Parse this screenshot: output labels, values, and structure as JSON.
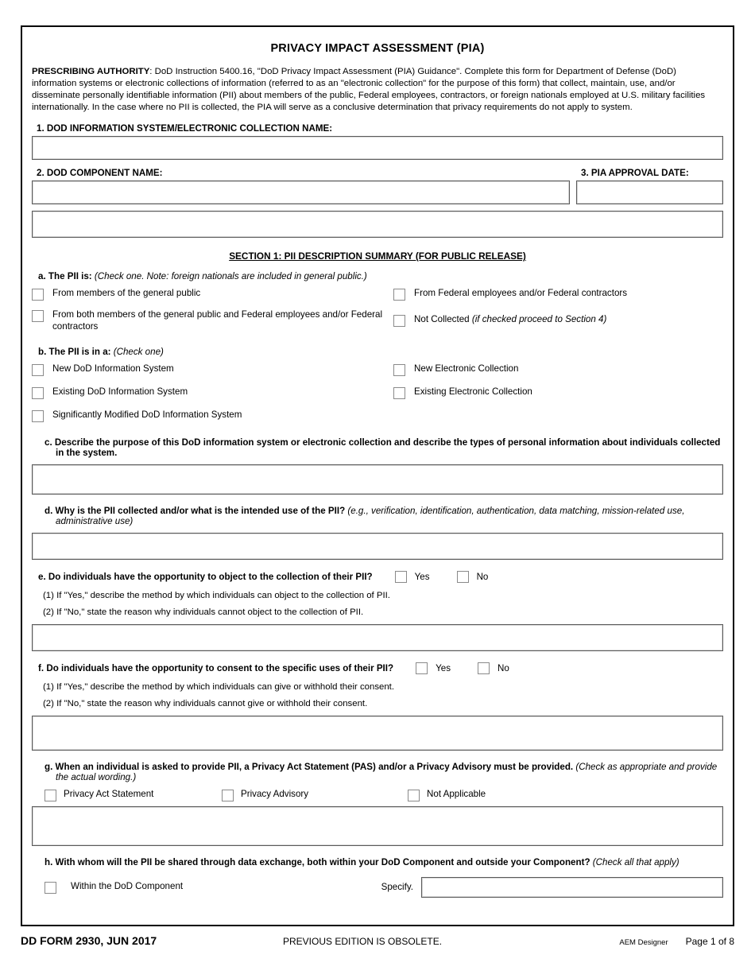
{
  "form": {
    "title": "PRIVACY IMPACT ASSESSMENT (PIA)",
    "prescribing_label": "PRESCRIBING AUTHORITY",
    "prescribing_text": ":  DoD Instruction 5400.16, \"DoD Privacy Impact Assessment (PIA) Guidance\".  Complete this form for Department of Defense (DoD) information systems or electronic collections of information (referred to as an \"electronic collection\" for the purpose of this form) that collect, maintain, use, and/or disseminate personally identifiable information (PII) about members of the public, Federal employees, contractors, or foreign nationals employed at U.S. military facilities internationally.  In the case where no PII is collected, the PIA will serve as a conclusive determination that privacy requirements do not apply to system."
  },
  "fields": {
    "f1_label": "1. DOD INFORMATION SYSTEM/ELECTRONIC COLLECTION NAME:",
    "f1_value": "",
    "f2_label": "2. DOD COMPONENT NAME:",
    "f2_value": "",
    "f3_label": "3. PIA  APPROVAL DATE:",
    "f3_value": "",
    "f4_value": ""
  },
  "section1": {
    "heading": "SECTION 1: PII DESCRIPTION SUMMARY (FOR PUBLIC RELEASE)",
    "a": {
      "letter": "a.",
      "label": "The PII is:",
      "note": "(Check one.  Note: foreign nationals are included in general public.)",
      "options_left": [
        "From members of the general public",
        "From both members of the general public and Federal employees and/or Federal contractors"
      ],
      "options_right_1": "From Federal employees and/or Federal contractors",
      "options_right_2_plain": "Not Collected ",
      "options_right_2_italic": "(if checked proceed to Section 4)"
    },
    "b": {
      "letter": "b.",
      "label": "The PII is in a:",
      "note": "(Check one)",
      "options_left": [
        "New DoD Information System",
        "Existing DoD Information System",
        "Significantly Modified DoD Information System"
      ],
      "options_right": [
        "New Electronic Collection",
        "Existing Electronic Collection"
      ]
    },
    "c": {
      "letter": "c.",
      "text": "Describe the purpose of this DoD information system or electronic collection and describe the types of personal information about individuals collected in the system.",
      "value": ""
    },
    "d": {
      "letter": "d.",
      "text": "Why is the PII collected and/or what is the intended use of the PII?",
      "note": "(e.g., verification, identification, authentication, data matching, mission-related use, administrative use)",
      "value": ""
    },
    "e": {
      "letter": "e.",
      "question": "Do individuals have the opportunity to object to the collection of their PII?",
      "yes_label": "Yes",
      "no_label": "No",
      "sub1": "(1) If \"Yes,\" describe the method by which individuals can object to the collection of PII.",
      "sub2": "(2) If \"No,\" state the reason why individuals cannot object to the collection of PII.",
      "value": ""
    },
    "f": {
      "letter": "f.",
      "question": "Do individuals have the opportunity to consent to the specific uses of their PII?",
      "yes_label": "Yes",
      "no_label": "No",
      "sub1": "(1) If \"Yes,\" describe the method by which individuals can give or withhold their consent.",
      "sub2": "(2) If \"No,\" state the reason why individuals cannot give or withhold their consent.",
      "value": ""
    },
    "g": {
      "letter": "g.",
      "text": "When an individual is asked to provide PII, a Privacy Act Statement (PAS) and/or a Privacy Advisory must be provided.",
      "note": "(Check as appropriate and provide the actual wording.)",
      "options": [
        "Privacy Act Statement",
        "Privacy Advisory",
        "Not Applicable"
      ],
      "value": ""
    },
    "h": {
      "letter": "h.",
      "text": "With whom will the PII be shared through data exchange, both within your DoD Component and outside your Component?",
      "note": "(Check all that apply)",
      "option": "Within the DoD Component",
      "specify_label": "Specify.",
      "specify_value": ""
    }
  },
  "footer": {
    "form_id": "DD FORM 2930, JUN 2017",
    "previous_edition": "PREVIOUS EDITION IS OBSOLETE.",
    "designer": "AEM Designer",
    "page": "Page 1 of 8"
  }
}
